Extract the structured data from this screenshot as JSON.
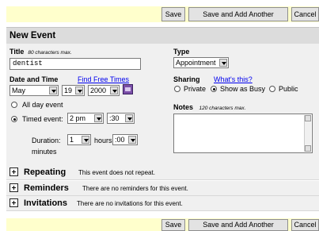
{
  "toolbar": {
    "save": "Save",
    "save_another": "Save and Add Another",
    "cancel": "Cancel"
  },
  "form": {
    "heading": "New Event",
    "title_label": "Title",
    "title_hint": "80 characters max.",
    "title_value": "dentist",
    "type_label": "Type",
    "type_value": "Appointment",
    "date_time_label": "Date and Time",
    "find_free_times": "Find Free Times",
    "month": "May",
    "day": "19",
    "year": "2000",
    "all_day": "All day event",
    "timed": "Timed event:",
    "hour": "2 pm",
    "minute": ":30",
    "duration_label": "Duration:",
    "duration_hours": "1",
    "hours_label": "hours",
    "duration_minutes": ":00",
    "minutes_label": "minutes",
    "sharing_label": "Sharing",
    "whats_this": "What's this?",
    "private": "Private",
    "show_busy": "Show as Busy",
    "public": "Public",
    "notes_label": "Notes",
    "notes_hint": "120 characters max."
  },
  "sections": [
    {
      "title": "Repeating",
      "desc": "This event does not repeat."
    },
    {
      "title": "Reminders",
      "desc": "There are no reminders for this event."
    },
    {
      "title": "Invitations",
      "desc": "There are no invitations for this event."
    }
  ],
  "colors": {
    "bar": "#ffffcc",
    "panel": "#f0f0f0",
    "heading": "#dcdcdc",
    "link": "#0000ee"
  }
}
